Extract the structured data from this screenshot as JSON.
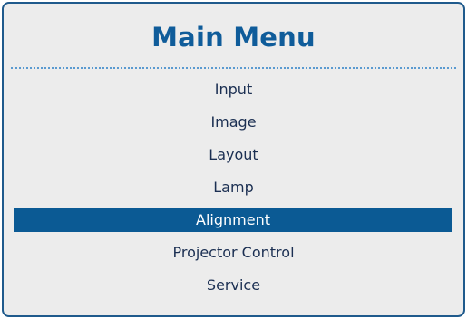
{
  "menu": {
    "title": "Main Menu",
    "items": [
      {
        "label": "Input"
      },
      {
        "label": "Image"
      },
      {
        "label": "Layout"
      },
      {
        "label": "Lamp"
      },
      {
        "label": "Alignment",
        "selected": true
      },
      {
        "label": "Projector Control"
      },
      {
        "label": "Service"
      }
    ]
  },
  "colors": {
    "title": "#0f5c9a",
    "selected_background": "#0b5a94",
    "panel_background": "#ececec",
    "frame_border": "#1f5a8c"
  }
}
